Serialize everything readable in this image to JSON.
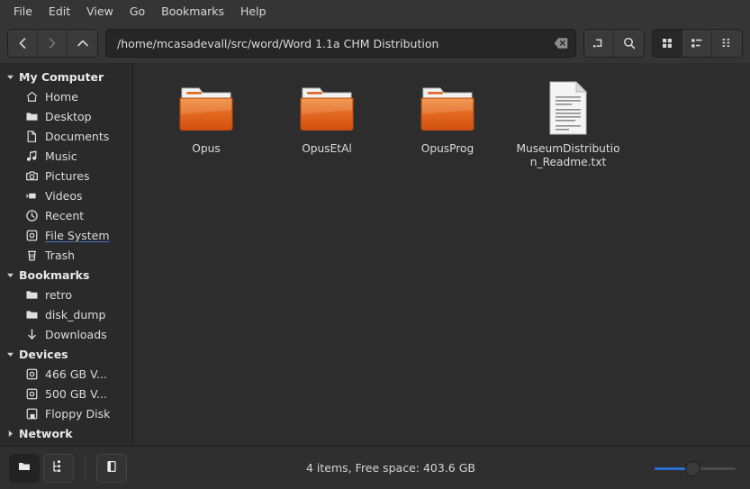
{
  "menubar": {
    "items": [
      {
        "label": "File"
      },
      {
        "label": "Edit"
      },
      {
        "label": "View"
      },
      {
        "label": "Go"
      },
      {
        "label": "Bookmarks"
      },
      {
        "label": "Help"
      }
    ]
  },
  "toolbar": {
    "back": {
      "name": "back-button",
      "icon": "chevron-left-icon",
      "enabled": true
    },
    "forward": {
      "name": "forward-button",
      "icon": "chevron-right-icon",
      "enabled": false
    },
    "up": {
      "name": "up-button",
      "icon": "chevron-up-icon",
      "enabled": true
    },
    "path": {
      "value": "/home/mcasadevall/src/word/Word 1.1a CHM Distribution",
      "placeholder": "Location",
      "clear_icon": "clear-backspace-icon"
    },
    "toggle_path_bar": {
      "icon": "path-entry-toggle-icon"
    },
    "search": {
      "icon": "search-icon"
    },
    "view_modes": [
      {
        "name": "icon-view",
        "icon": "grid-view-icon",
        "active": true
      },
      {
        "name": "list-view",
        "icon": "list-view-icon",
        "active": false
      },
      {
        "name": "compact-view",
        "icon": "compact-view-icon",
        "active": false
      }
    ]
  },
  "sidebar": {
    "groups": [
      {
        "label": "My Computer",
        "expanded": true,
        "items": [
          {
            "label": "Home",
            "icon": "home-icon"
          },
          {
            "label": "Desktop",
            "icon": "folder-icon"
          },
          {
            "label": "Documents",
            "icon": "document-icon"
          },
          {
            "label": "Music",
            "icon": "music-note-icon"
          },
          {
            "label": "Pictures",
            "icon": "camera-icon"
          },
          {
            "label": "Videos",
            "icon": "video-camera-icon"
          },
          {
            "label": "Recent",
            "icon": "clock-icon"
          },
          {
            "label": "File System",
            "icon": "drive-icon",
            "hovered": true
          },
          {
            "label": "Trash",
            "icon": "trash-icon"
          }
        ]
      },
      {
        "label": "Bookmarks",
        "expanded": true,
        "items": [
          {
            "label": "retro",
            "icon": "folder-icon"
          },
          {
            "label": "disk_dump",
            "icon": "folder-icon"
          },
          {
            "label": "Downloads",
            "icon": "download-arrow-icon"
          }
        ]
      },
      {
        "label": "Devices",
        "expanded": true,
        "items": [
          {
            "label": "466 GB V...",
            "icon": "drive-icon"
          },
          {
            "label": "500 GB V...",
            "icon": "drive-icon"
          },
          {
            "label": "Floppy Disk",
            "icon": "floppy-icon"
          }
        ]
      },
      {
        "label": "Network",
        "expanded": false,
        "items": []
      }
    ]
  },
  "files": [
    {
      "name": "Opus",
      "type": "folder"
    },
    {
      "name": "OpusEtAl",
      "type": "folder"
    },
    {
      "name": "OpusProg",
      "type": "folder"
    },
    {
      "name": "MuseumDistribution_Readme.txt",
      "type": "text"
    }
  ],
  "statusbar": {
    "sidebar_modes": [
      {
        "name": "places-view",
        "icon": "folder-icon",
        "active": true
      },
      {
        "name": "tree-view",
        "icon": "tree-icon",
        "active": false
      }
    ],
    "panel_toggle": {
      "name": "side-panel-toggle",
      "icon": "panel-icon"
    },
    "status_text": "4 items, Free space: 403.6 GB",
    "zoom": {
      "value": 50,
      "min": 0,
      "max": 100
    }
  },
  "colors": {
    "menubar_bg": "#353535",
    "pane_bg": "#2d2d2d",
    "sidebar_bg": "#2a2a2a",
    "accent": "#2a6fd4",
    "folder_orange": "#e8762c",
    "text": "#dcdcdc"
  }
}
